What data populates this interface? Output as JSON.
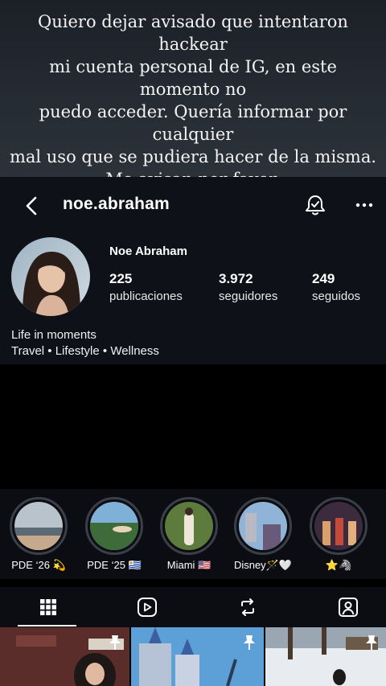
{
  "story_message": "Quiero dejar avisado que intentaron hackear\nmi cuenta personal de IG, en este momento no\npuedo acceder. Quería informar por cualquier\nmal uso que se pudiera hacer de la misma.\nMe avisan por favor.\nGracias! 🫶🏼",
  "profile": {
    "username": "noe.abraham",
    "full_name": "Noe Abraham",
    "stats": [
      {
        "value": "225",
        "label": "publicaciones"
      },
      {
        "value": "3.972",
        "label": "seguidores"
      },
      {
        "value": "249",
        "label": "seguidos"
      }
    ],
    "bio_line1": "Life in moments",
    "bio_line2": "Travel • Lifestyle • Wellness"
  },
  "highlights": [
    {
      "label": "PDE ‘26 💫"
    },
    {
      "label": "PDE ‘25 🇺🇾"
    },
    {
      "label": "Miami 🇺🇸"
    },
    {
      "label": "Disney🪄🤍"
    },
    {
      "label": "⭐️🦓"
    }
  ],
  "tabs": [
    "grid-icon",
    "reels-icon",
    "reposts-icon",
    "tagged-icon"
  ],
  "colors": {
    "profile_bg": "#0e1118",
    "overlay_bg": "#252b33"
  }
}
